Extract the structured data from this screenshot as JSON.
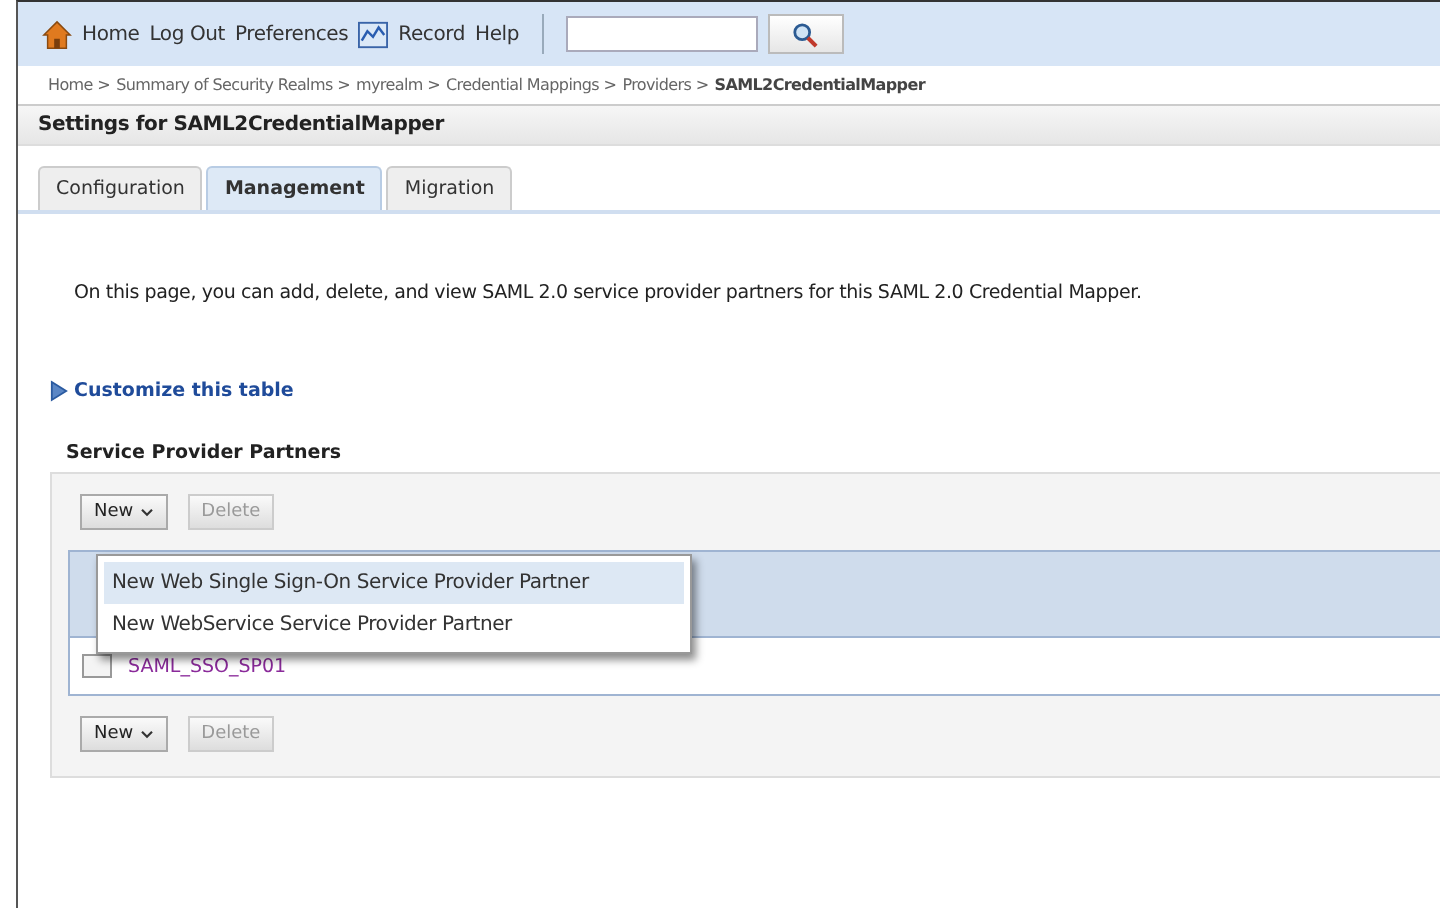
{
  "toolbar": {
    "items": [
      {
        "kind": "home",
        "label": "Home"
      },
      {
        "kind": "link",
        "label": "Log Out"
      },
      {
        "kind": "link",
        "label": "Preferences"
      },
      {
        "kind": "record",
        "label": "Record"
      },
      {
        "kind": "link",
        "label": "Help"
      }
    ]
  },
  "breadcrumb": {
    "items": [
      "Home >",
      "Summary of Security Realms >",
      "myrealm >",
      "Credential Mappings >",
      "Providers >"
    ],
    "current": "SAML2CredentialMapper"
  },
  "settings_title": "Settings for SAML2CredentialMapper",
  "tabs": [
    {
      "label": "Configuration",
      "selected": false
    },
    {
      "label": "Management",
      "selected": true
    },
    {
      "label": "Migration",
      "selected": false
    }
  ],
  "description": "On this page, you can add, delete, and view SAML 2.0 service provider partners for this SAML 2.0 Credential Mapper.",
  "customize_link": "Customize this table",
  "table": {
    "title": "Service Provider Partners",
    "toolbars": [
      {
        "new_button": "New",
        "delete_button": "Delete",
        "delete_disabled": true
      },
      {
        "new_button": "New",
        "delete_button": "Delete",
        "delete_disabled": true
      }
    ],
    "rows": [
      {
        "name": "SAML_SSO_SP01",
        "checked": false
      }
    ],
    "menu": {
      "open": true,
      "items": [
        {
          "label": "New Web Single Sign-On Service Provider Partner",
          "selected": true
        },
        {
          "label": "New WebService Service Provider Partner",
          "selected": false
        }
      ]
    }
  }
}
